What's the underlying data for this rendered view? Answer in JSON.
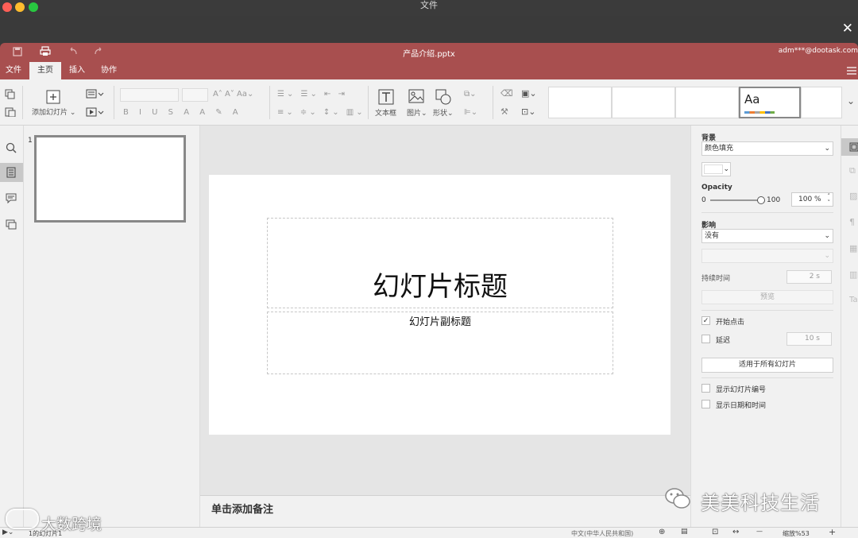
{
  "mac": {
    "title": "文件",
    "close": "✕"
  },
  "app": {
    "doc_title": "产品介绍.pptx",
    "user": "adm***@dootask.com",
    "colors": {
      "accent": "#a84f4f"
    }
  },
  "menu": {
    "items": [
      "文件",
      "主页",
      "插入",
      "协作"
    ],
    "active": "主页"
  },
  "ribbon": {
    "add_slide": "添加幻灯片",
    "textbox": "文本框",
    "image": "图片",
    "shape": "形状",
    "theme_sample": "Aa"
  },
  "thumbs": {
    "slide_number": "1"
  },
  "slide": {
    "title": "幻灯片标题",
    "subtitle": "幻灯片副标题"
  },
  "notes": {
    "placeholder": "单击添加备注"
  },
  "panel": {
    "background_label": "背景",
    "background_value": "颜色填充",
    "opacity_label": "Opacity",
    "opacity_min": "0",
    "opacity_max": "100",
    "opacity_value": "100 %",
    "opacity_level": 1.0,
    "effect_label": "影响",
    "effect_value": "没有",
    "duration_label": "持续时间",
    "duration_value": "2 s",
    "preview": "预览",
    "start_click": "开始点击",
    "start_click_checked": true,
    "delay": "延迟",
    "delay_value": "10 s",
    "apply_all": "适用于所有幻灯片",
    "show_number": "显示幻灯片编号",
    "show_datetime": "显示日期和时间"
  },
  "status": {
    "slide_info": "1的幻灯片1",
    "language": "中文(中华人民共和国)",
    "zoom": "缩放%53",
    "zoom_minus": "—",
    "zoom_plus": "+"
  },
  "watermark": {
    "right": "美美科技生活",
    "left": "大数跨境"
  }
}
